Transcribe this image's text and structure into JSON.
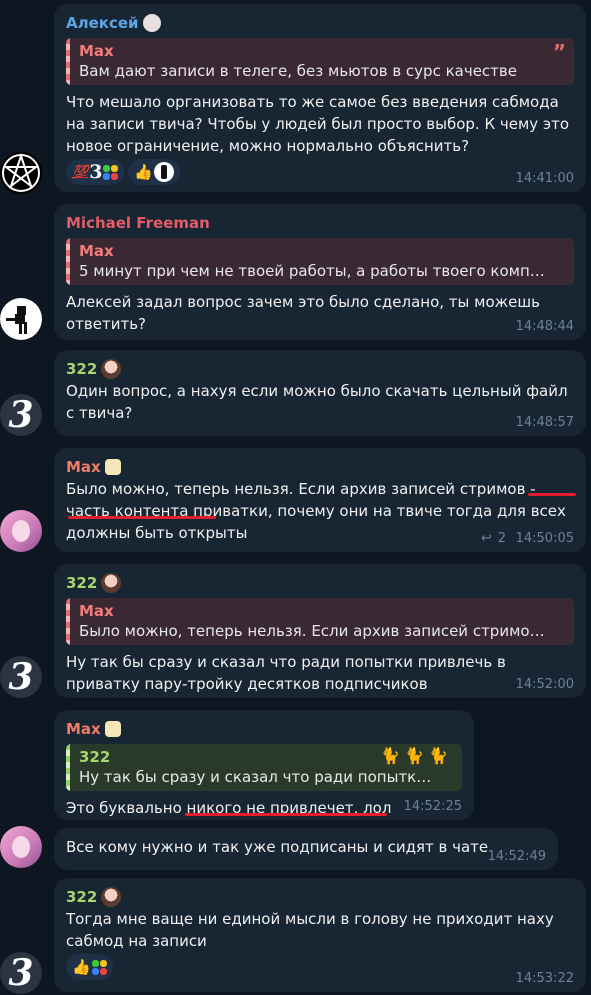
{
  "messages": [
    {
      "sender": "Алексей",
      "sender_color": "#5ea5e6",
      "reply": {
        "name": "Max",
        "text": "Вам дают записи в телеге, без мьютов в сурс качестве"
      },
      "text": "Что мешало организовать то же самое без введения сабмода на записи твича? Чтобы у людей был просто выбор. К чему это новое ограничение, можно нормально объяснить?",
      "reactions": [
        "💯",
        "3",
        "👍"
      ],
      "time": "14:41:00"
    },
    {
      "sender": "Michael Freeman",
      "sender_color": "#e15d68",
      "reply": {
        "name": "Max",
        "text": "5 минут при чем не твоей работы, а работы твоего компа. О..."
      },
      "text": "Алексей задал вопрос зачем это было сделано, ты можешь ответить?",
      "time": "14:48:44"
    },
    {
      "sender": "322",
      "sender_color": "#a5d66a",
      "text": "Один вопрос, а нахуя если можно было скачать цельный файл с твича?",
      "time": "14:48:57"
    },
    {
      "sender": "Max",
      "sender_color": "#f07c65",
      "text": "Было можно, теперь нельзя. Если архив записей стримов - часть контента приватки, почему они на твиче тогда для всех должны быть открыты",
      "replies_count": "2",
      "time": "14:50:05"
    },
    {
      "sender": "322",
      "sender_color": "#a5d66a",
      "reply": {
        "name": "Max",
        "text": "Было можно, теперь нельзя. Если архив записей стримов - ч..."
      },
      "text": "Ну так бы сразу и сказал что ради попытки привлечь в приватку пару-тройку десятков подписчиков",
      "time": "14:52:00"
    },
    {
      "sender": "Max",
      "sender_color": "#f07c65",
      "reply": {
        "name": "322",
        "text": "Ну так бы сразу и сказал что ради попытки пр..."
      },
      "text": "Это буквально никого не привлечет, лол",
      "time": "14:52:25"
    },
    {
      "text": "Все кому нужно и так уже подписаны и сидят в чате",
      "time": "14:52:49"
    },
    {
      "sender": "322",
      "sender_color": "#a5d66a",
      "text": "Тогда мне ваще ни единой мысли в голову не приходит наху сабмод на записи",
      "reactions": [
        "👍"
      ],
      "time": "14:53:22"
    }
  ]
}
